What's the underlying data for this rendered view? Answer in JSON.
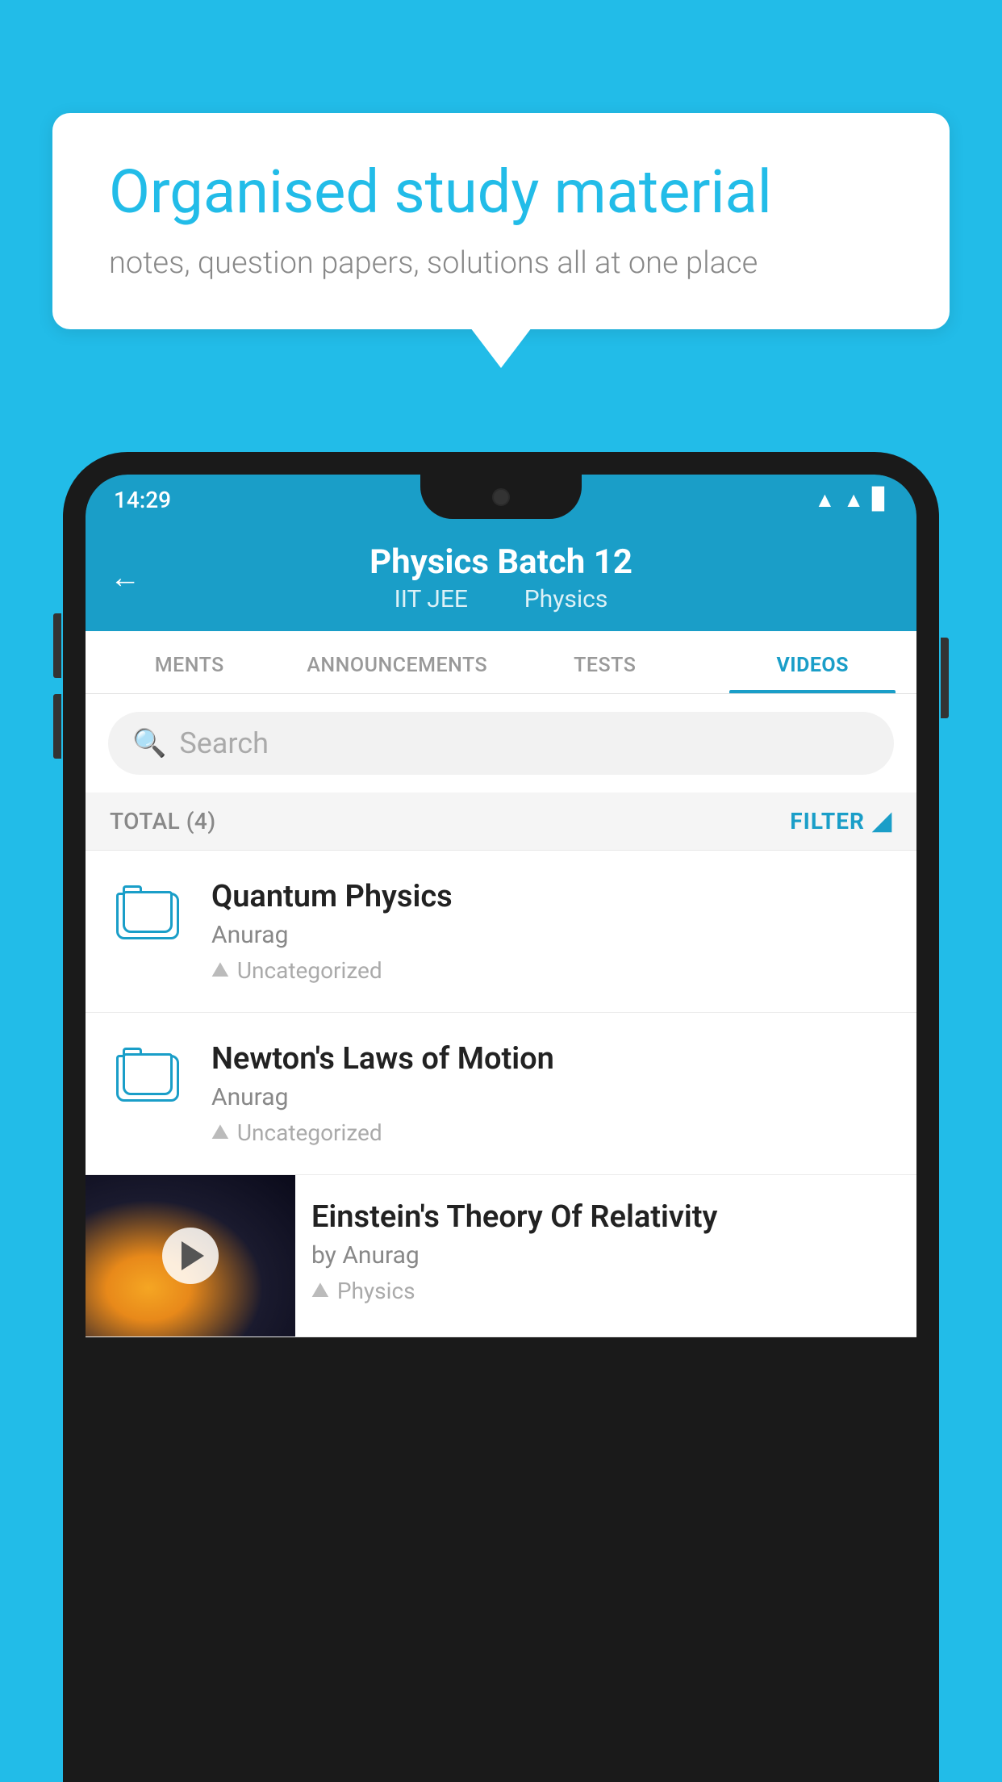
{
  "background_color": "#22bce8",
  "speech_bubble": {
    "headline": "Organised study material",
    "subtext": "notes, question papers, solutions all at one place"
  },
  "status_bar": {
    "time": "14:29",
    "wifi": "▲",
    "signal": "▲",
    "battery": "▊"
  },
  "app_header": {
    "back_label": "←",
    "title": "Physics Batch 12",
    "subtitle_part1": "IIT JEE",
    "subtitle_part2": "Physics"
  },
  "tabs": [
    {
      "label": "MENTS",
      "active": false
    },
    {
      "label": "ANNOUNCEMENTS",
      "active": false
    },
    {
      "label": "TESTS",
      "active": false
    },
    {
      "label": "VIDEOS",
      "active": true
    }
  ],
  "search": {
    "placeholder": "Search"
  },
  "filter_bar": {
    "total_label": "TOTAL (4)",
    "filter_label": "FILTER"
  },
  "video_items": [
    {
      "title": "Quantum Physics",
      "author": "Anurag",
      "tag": "Uncategorized",
      "has_thumb": false
    },
    {
      "title": "Newton's Laws of Motion",
      "author": "Anurag",
      "tag": "Uncategorized",
      "has_thumb": false
    },
    {
      "title": "Einstein's Theory Of Relativity",
      "author": "by Anurag",
      "tag": "Physics",
      "has_thumb": true
    }
  ]
}
